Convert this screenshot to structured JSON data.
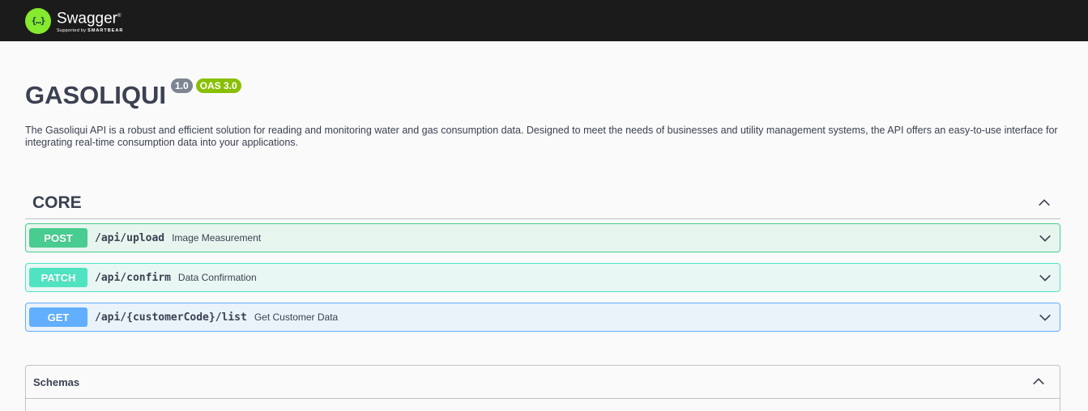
{
  "topbar": {
    "brand": "Swagger",
    "brand_tm": "®",
    "supported_by": "Supported by",
    "company": "SMARTBEAR",
    "logo_glyph": "{…}"
  },
  "info": {
    "title": "GASOLIQUI",
    "version": "1.0",
    "oas": "OAS 3.0",
    "description": "The Gasoliqui API is a robust and efficient solution for reading and monitoring water and gas consumption data. Designed to meet the needs of businesses and utility management systems, the API offers an easy-to-use interface for integrating real-time consumption data into your applications."
  },
  "tag": {
    "name": "CORE",
    "expanded": true,
    "operations": [
      {
        "method": "POST",
        "path": "/api/upload",
        "summary": "Image Measurement"
      },
      {
        "method": "PATCH",
        "path": "/api/confirm",
        "summary": "Data Confirmation"
      },
      {
        "method": "GET",
        "path": "/api/{customerCode}/list",
        "summary": "Get Customer Data"
      }
    ]
  },
  "schemas": {
    "title": "Schemas",
    "expanded": true
  },
  "colors": {
    "topbar_bg": "#1b1b1b",
    "logo_green": "#85ea2d",
    "post": "#49cc90",
    "patch": "#50e3c2",
    "get": "#61affe",
    "version_badge": "#7d8492",
    "oas_badge": "#89bf04"
  },
  "icons": {
    "collapse": "chevron-up-icon",
    "expand": "chevron-down-icon"
  }
}
